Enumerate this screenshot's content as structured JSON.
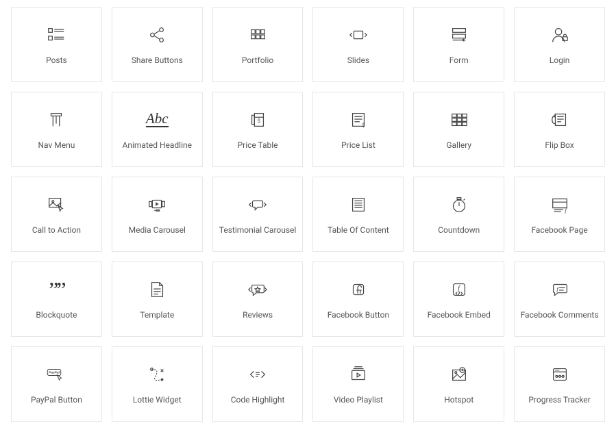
{
  "widgets": [
    {
      "label": "Posts",
      "icon": "posts-icon"
    },
    {
      "label": "Share Buttons",
      "icon": "share-icon"
    },
    {
      "label": "Portfolio",
      "icon": "portfolio-icon"
    },
    {
      "label": "Slides",
      "icon": "slides-icon"
    },
    {
      "label": "Form",
      "icon": "form-icon"
    },
    {
      "label": "Login",
      "icon": "login-icon"
    },
    {
      "label": "Nav Menu",
      "icon": "nav-menu-icon"
    },
    {
      "label": "Animated Headline",
      "icon": "animated-headline-icon"
    },
    {
      "label": "Price Table",
      "icon": "price-table-icon"
    },
    {
      "label": "Price List",
      "icon": "price-list-icon"
    },
    {
      "label": "Gallery",
      "icon": "gallery-icon"
    },
    {
      "label": "Flip Box",
      "icon": "flip-box-icon"
    },
    {
      "label": "Call to Action",
      "icon": "call-to-action-icon"
    },
    {
      "label": "Media Carousel",
      "icon": "media-carousel-icon"
    },
    {
      "label": "Testimonial Carousel",
      "icon": "testimonial-carousel-icon"
    },
    {
      "label": "Table Of Content",
      "icon": "table-of-content-icon"
    },
    {
      "label": "Countdown",
      "icon": "countdown-icon"
    },
    {
      "label": "Facebook Page",
      "icon": "facebook-page-icon"
    },
    {
      "label": "Blockquote",
      "icon": "blockquote-icon"
    },
    {
      "label": "Template",
      "icon": "template-icon"
    },
    {
      "label": "Reviews",
      "icon": "reviews-icon"
    },
    {
      "label": "Facebook Button",
      "icon": "facebook-button-icon"
    },
    {
      "label": "Facebook Embed",
      "icon": "facebook-embed-icon"
    },
    {
      "label": "Facebook Comments",
      "icon": "facebook-comments-icon"
    },
    {
      "label": "PayPal Button",
      "icon": "paypal-button-icon"
    },
    {
      "label": "Lottie Widget",
      "icon": "lottie-widget-icon"
    },
    {
      "label": "Code Highlight",
      "icon": "code-highlight-icon"
    },
    {
      "label": "Video Playlist",
      "icon": "video-playlist-icon"
    },
    {
      "label": "Hotspot",
      "icon": "hotspot-icon"
    },
    {
      "label": "Progress Tracker",
      "icon": "progress-tracker-icon"
    }
  ],
  "abc_text": "Abc",
  "paypal_text": "PayPal",
  "f_text": "f"
}
